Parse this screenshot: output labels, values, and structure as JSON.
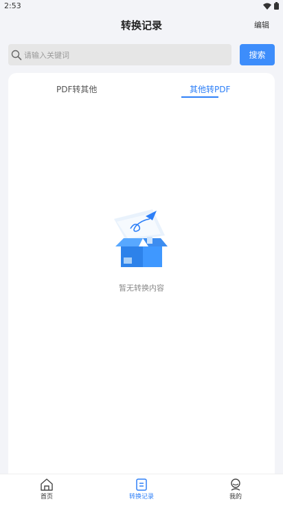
{
  "status_bar": {
    "time": "2:53"
  },
  "header": {
    "title": "转换记录",
    "edit_label": "编辑"
  },
  "search": {
    "placeholder": "请输入关键词",
    "button_label": "搜索"
  },
  "tabs": [
    {
      "label": "PDF转其他",
      "active": false
    },
    {
      "label": "其他转PDF",
      "active": true
    }
  ],
  "empty_state": {
    "message": "暂无转换内容"
  },
  "bottom_nav": [
    {
      "label": "首页",
      "icon": "home-icon",
      "active": false
    },
    {
      "label": "转换记录",
      "icon": "document-icon",
      "active": true
    },
    {
      "label": "我的",
      "icon": "user-icon",
      "active": false
    }
  ],
  "colors": {
    "accent": "#2d7ff7",
    "search_button": "#3d8dfb",
    "background": "#f3f4f8"
  }
}
